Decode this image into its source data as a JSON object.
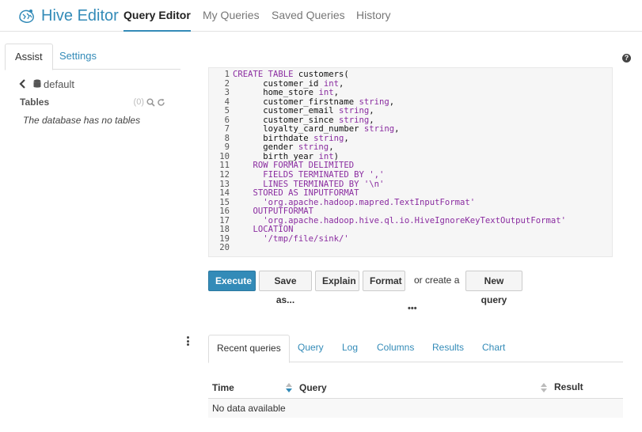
{
  "brand": {
    "title": "Hive Editor",
    "color": "#338bb8"
  },
  "nav": {
    "tabs": [
      {
        "label": "Query Editor",
        "active": true
      },
      {
        "label": "My Queries"
      },
      {
        "label": "Saved Queries"
      },
      {
        "label": "History"
      }
    ]
  },
  "assist": {
    "tabs": [
      {
        "label": "Assist",
        "active": true
      },
      {
        "label": "Settings"
      }
    ],
    "database": "default",
    "tables_label": "Tables",
    "tables_count": "(0)",
    "empty_message": "The database has no tables"
  },
  "editor": {
    "lines": [
      "CREATE TABLE customers(",
      "      customer_id int,",
      "      home_store int,",
      "      customer_firstname string,",
      "      customer_email string,",
      "      customer_since string,",
      "      loyalty_card_number string,",
      "      birthdate string,",
      "      gender string,",
      "      birth_year int)",
      "    ROW FORMAT DELIMITED",
      "      FIELDS TERMINATED BY ',' ",
      "      LINES TERMINATED BY '\\n'",
      "    STORED AS INPUTFORMAT",
      "      'org.apache.hadoop.mapred.TextInputFormat'",
      "    OUTPUTFORMAT",
      "      'org.apache.hadoop.hive.ql.io.HiveIgnoreKeyTextOutputFormat'",
      "    LOCATION",
      "      '/tmp/file/sink/'",
      ""
    ]
  },
  "actions": {
    "execute": "Execute",
    "save_as": "Save as...",
    "explain": "Explain",
    "format": "Format",
    "or_text": "or create a",
    "new_query": "New query",
    "ellipsis": "•••"
  },
  "results": {
    "tabs": [
      {
        "label": "Recent queries",
        "active": true
      },
      {
        "label": "Query"
      },
      {
        "label": "Log"
      },
      {
        "label": "Columns"
      },
      {
        "label": "Results"
      },
      {
        "label": "Chart"
      }
    ],
    "columns": {
      "time": "Time",
      "query": "Query",
      "result": "Result"
    },
    "empty": "No data available"
  },
  "help_icon": "?"
}
